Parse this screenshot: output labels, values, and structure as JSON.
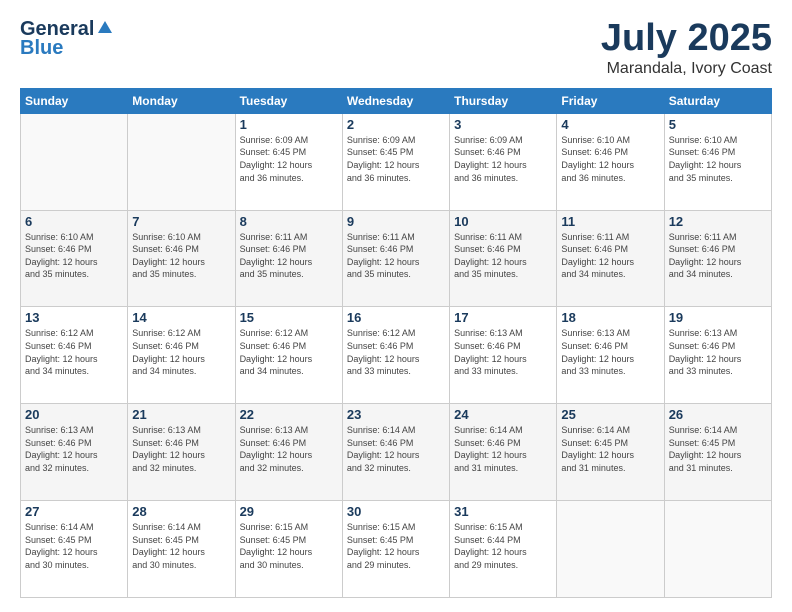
{
  "logo": {
    "general": "General",
    "blue": "Blue"
  },
  "title": "July 2025",
  "location": "Marandala, Ivory Coast",
  "weekdays": [
    "Sunday",
    "Monday",
    "Tuesday",
    "Wednesday",
    "Thursday",
    "Friday",
    "Saturday"
  ],
  "weeks": [
    [
      {
        "day": "",
        "info": ""
      },
      {
        "day": "",
        "info": ""
      },
      {
        "day": "1",
        "info": "Sunrise: 6:09 AM\nSunset: 6:45 PM\nDaylight: 12 hours\nand 36 minutes."
      },
      {
        "day": "2",
        "info": "Sunrise: 6:09 AM\nSunset: 6:45 PM\nDaylight: 12 hours\nand 36 minutes."
      },
      {
        "day": "3",
        "info": "Sunrise: 6:09 AM\nSunset: 6:46 PM\nDaylight: 12 hours\nand 36 minutes."
      },
      {
        "day": "4",
        "info": "Sunrise: 6:10 AM\nSunset: 6:46 PM\nDaylight: 12 hours\nand 36 minutes."
      },
      {
        "day": "5",
        "info": "Sunrise: 6:10 AM\nSunset: 6:46 PM\nDaylight: 12 hours\nand 35 minutes."
      }
    ],
    [
      {
        "day": "6",
        "info": "Sunrise: 6:10 AM\nSunset: 6:46 PM\nDaylight: 12 hours\nand 35 minutes."
      },
      {
        "day": "7",
        "info": "Sunrise: 6:10 AM\nSunset: 6:46 PM\nDaylight: 12 hours\nand 35 minutes."
      },
      {
        "day": "8",
        "info": "Sunrise: 6:11 AM\nSunset: 6:46 PM\nDaylight: 12 hours\nand 35 minutes."
      },
      {
        "day": "9",
        "info": "Sunrise: 6:11 AM\nSunset: 6:46 PM\nDaylight: 12 hours\nand 35 minutes."
      },
      {
        "day": "10",
        "info": "Sunrise: 6:11 AM\nSunset: 6:46 PM\nDaylight: 12 hours\nand 35 minutes."
      },
      {
        "day": "11",
        "info": "Sunrise: 6:11 AM\nSunset: 6:46 PM\nDaylight: 12 hours\nand 34 minutes."
      },
      {
        "day": "12",
        "info": "Sunrise: 6:11 AM\nSunset: 6:46 PM\nDaylight: 12 hours\nand 34 minutes."
      }
    ],
    [
      {
        "day": "13",
        "info": "Sunrise: 6:12 AM\nSunset: 6:46 PM\nDaylight: 12 hours\nand 34 minutes."
      },
      {
        "day": "14",
        "info": "Sunrise: 6:12 AM\nSunset: 6:46 PM\nDaylight: 12 hours\nand 34 minutes."
      },
      {
        "day": "15",
        "info": "Sunrise: 6:12 AM\nSunset: 6:46 PM\nDaylight: 12 hours\nand 34 minutes."
      },
      {
        "day": "16",
        "info": "Sunrise: 6:12 AM\nSunset: 6:46 PM\nDaylight: 12 hours\nand 33 minutes."
      },
      {
        "day": "17",
        "info": "Sunrise: 6:13 AM\nSunset: 6:46 PM\nDaylight: 12 hours\nand 33 minutes."
      },
      {
        "day": "18",
        "info": "Sunrise: 6:13 AM\nSunset: 6:46 PM\nDaylight: 12 hours\nand 33 minutes."
      },
      {
        "day": "19",
        "info": "Sunrise: 6:13 AM\nSunset: 6:46 PM\nDaylight: 12 hours\nand 33 minutes."
      }
    ],
    [
      {
        "day": "20",
        "info": "Sunrise: 6:13 AM\nSunset: 6:46 PM\nDaylight: 12 hours\nand 32 minutes."
      },
      {
        "day": "21",
        "info": "Sunrise: 6:13 AM\nSunset: 6:46 PM\nDaylight: 12 hours\nand 32 minutes."
      },
      {
        "day": "22",
        "info": "Sunrise: 6:13 AM\nSunset: 6:46 PM\nDaylight: 12 hours\nand 32 minutes."
      },
      {
        "day": "23",
        "info": "Sunrise: 6:14 AM\nSunset: 6:46 PM\nDaylight: 12 hours\nand 32 minutes."
      },
      {
        "day": "24",
        "info": "Sunrise: 6:14 AM\nSunset: 6:46 PM\nDaylight: 12 hours\nand 31 minutes."
      },
      {
        "day": "25",
        "info": "Sunrise: 6:14 AM\nSunset: 6:45 PM\nDaylight: 12 hours\nand 31 minutes."
      },
      {
        "day": "26",
        "info": "Sunrise: 6:14 AM\nSunset: 6:45 PM\nDaylight: 12 hours\nand 31 minutes."
      }
    ],
    [
      {
        "day": "27",
        "info": "Sunrise: 6:14 AM\nSunset: 6:45 PM\nDaylight: 12 hours\nand 30 minutes."
      },
      {
        "day": "28",
        "info": "Sunrise: 6:14 AM\nSunset: 6:45 PM\nDaylight: 12 hours\nand 30 minutes."
      },
      {
        "day": "29",
        "info": "Sunrise: 6:15 AM\nSunset: 6:45 PM\nDaylight: 12 hours\nand 30 minutes."
      },
      {
        "day": "30",
        "info": "Sunrise: 6:15 AM\nSunset: 6:45 PM\nDaylight: 12 hours\nand 29 minutes."
      },
      {
        "day": "31",
        "info": "Sunrise: 6:15 AM\nSunset: 6:44 PM\nDaylight: 12 hours\nand 29 minutes."
      },
      {
        "day": "",
        "info": ""
      },
      {
        "day": "",
        "info": ""
      }
    ]
  ]
}
